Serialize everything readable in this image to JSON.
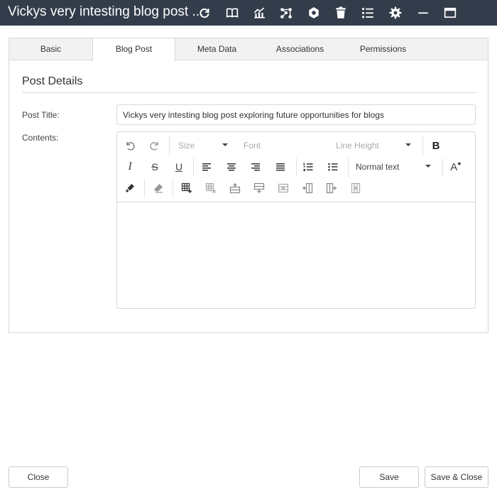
{
  "window": {
    "title": "Vickys very intesting blog post ...",
    "icons": [
      "refresh-icon",
      "book-icon",
      "chart-icon",
      "network-icon",
      "hexagon-gear-icon",
      "trash-icon",
      "list-icon",
      "settings-icon",
      "minimize-icon",
      "maximize-icon"
    ]
  },
  "tabs": [
    {
      "label": "Basic",
      "active": false
    },
    {
      "label": "Blog Post",
      "active": true
    },
    {
      "label": "Meta Data",
      "active": false
    },
    {
      "label": "Associations",
      "active": false
    },
    {
      "label": "Permissions",
      "active": false
    }
  ],
  "section": {
    "title": "Post Details"
  },
  "form": {
    "post_title_label": "Post Title:",
    "post_title_value": "Vickys very intesting blog post exploring future opportunities for blogs",
    "contents_label": "Contents:"
  },
  "editor": {
    "size_label": "Size",
    "font_label": "Font",
    "line_height_label": "Line Height",
    "bold_label": "B",
    "italic_label": "I",
    "strike_label": "S",
    "underline_label": "U",
    "paragraph_style": "Normal text",
    "font_case_label": "A"
  },
  "footer": {
    "close_label": "Close",
    "save_label": "Save",
    "save_close_label": "Save & Close"
  },
  "colors": {
    "titlebar_bg": "#333c4a",
    "border": "#d9d9d9",
    "tab_strip_bg": "#f2f2f2"
  }
}
